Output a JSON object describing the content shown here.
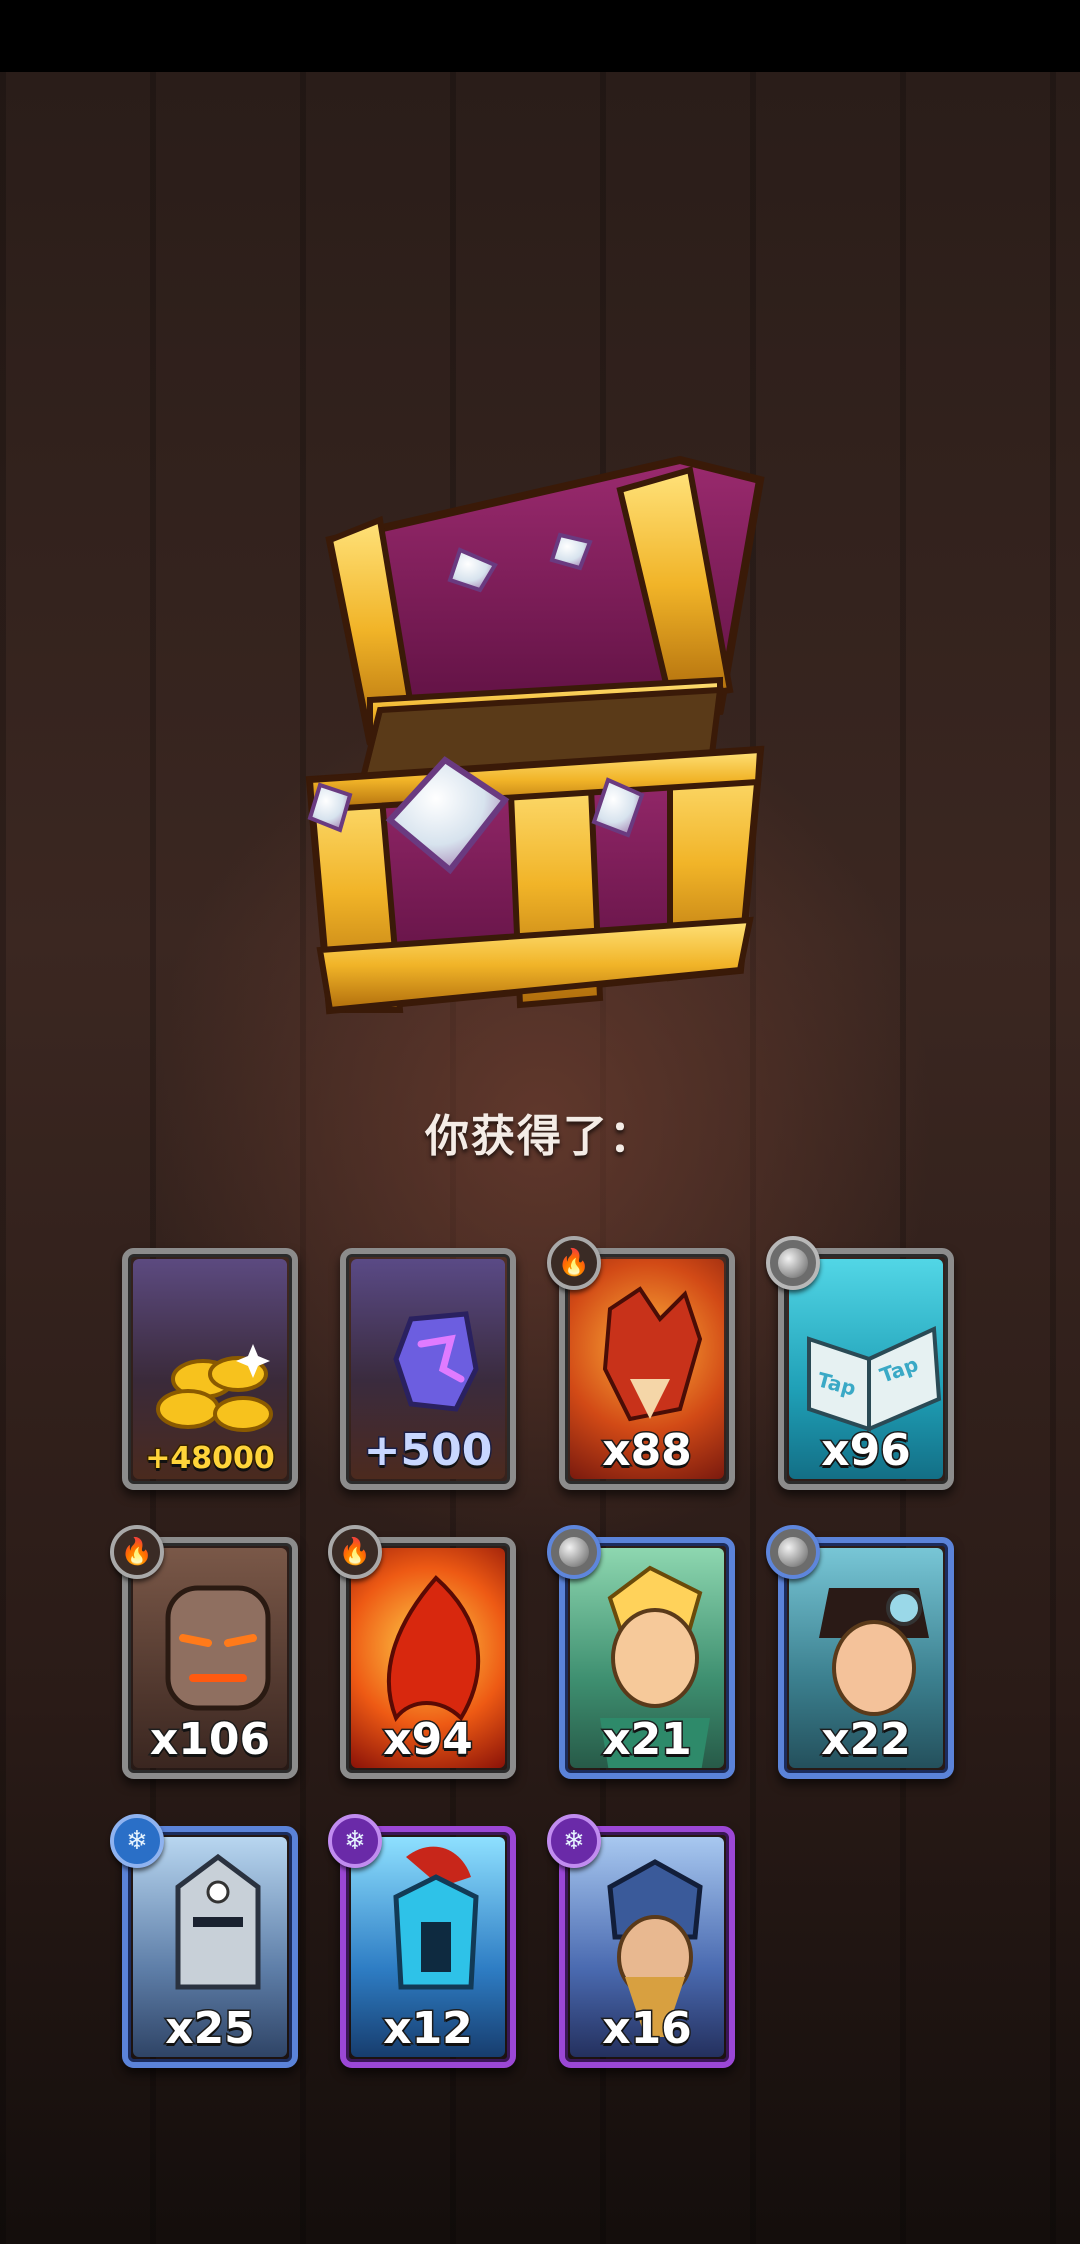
{
  "title": "你获得了：",
  "rewards": [
    {
      "name": "gold-coins",
      "count": "+48000",
      "badge": "",
      "rarity": "gray"
    },
    {
      "name": "purple-gem",
      "count": "+500",
      "badge": "",
      "rarity": "gray"
    },
    {
      "name": "fire-fox-hero",
      "count": "x88",
      "badge": "fire-icon",
      "rarity": "gray"
    },
    {
      "name": "tap-tap-book",
      "count": "x96",
      "badge": "orb-icon",
      "rarity": "gray"
    },
    {
      "name": "lava-golem-hero",
      "count": "x106",
      "badge": "fire-icon",
      "rarity": "gray"
    },
    {
      "name": "flame-spirit-hero",
      "count": "x94",
      "badge": "fire-icon",
      "rarity": "gray"
    },
    {
      "name": "elf-archer-hero",
      "count": "x21",
      "badge": "orb-icon",
      "rarity": "blue"
    },
    {
      "name": "goggle-pilot-hero",
      "count": "x22",
      "badge": "orb-icon",
      "rarity": "blue"
    },
    {
      "name": "skull-knight-hero",
      "count": "x25",
      "badge": "ice-icon",
      "rarity": "blue"
    },
    {
      "name": "spartan-warrior-hero",
      "count": "x12",
      "badge": "ice-icon",
      "rarity": "purple"
    },
    {
      "name": "thunder-king-hero",
      "count": "x16",
      "badge": "ice-icon",
      "rarity": "purple"
    }
  ]
}
